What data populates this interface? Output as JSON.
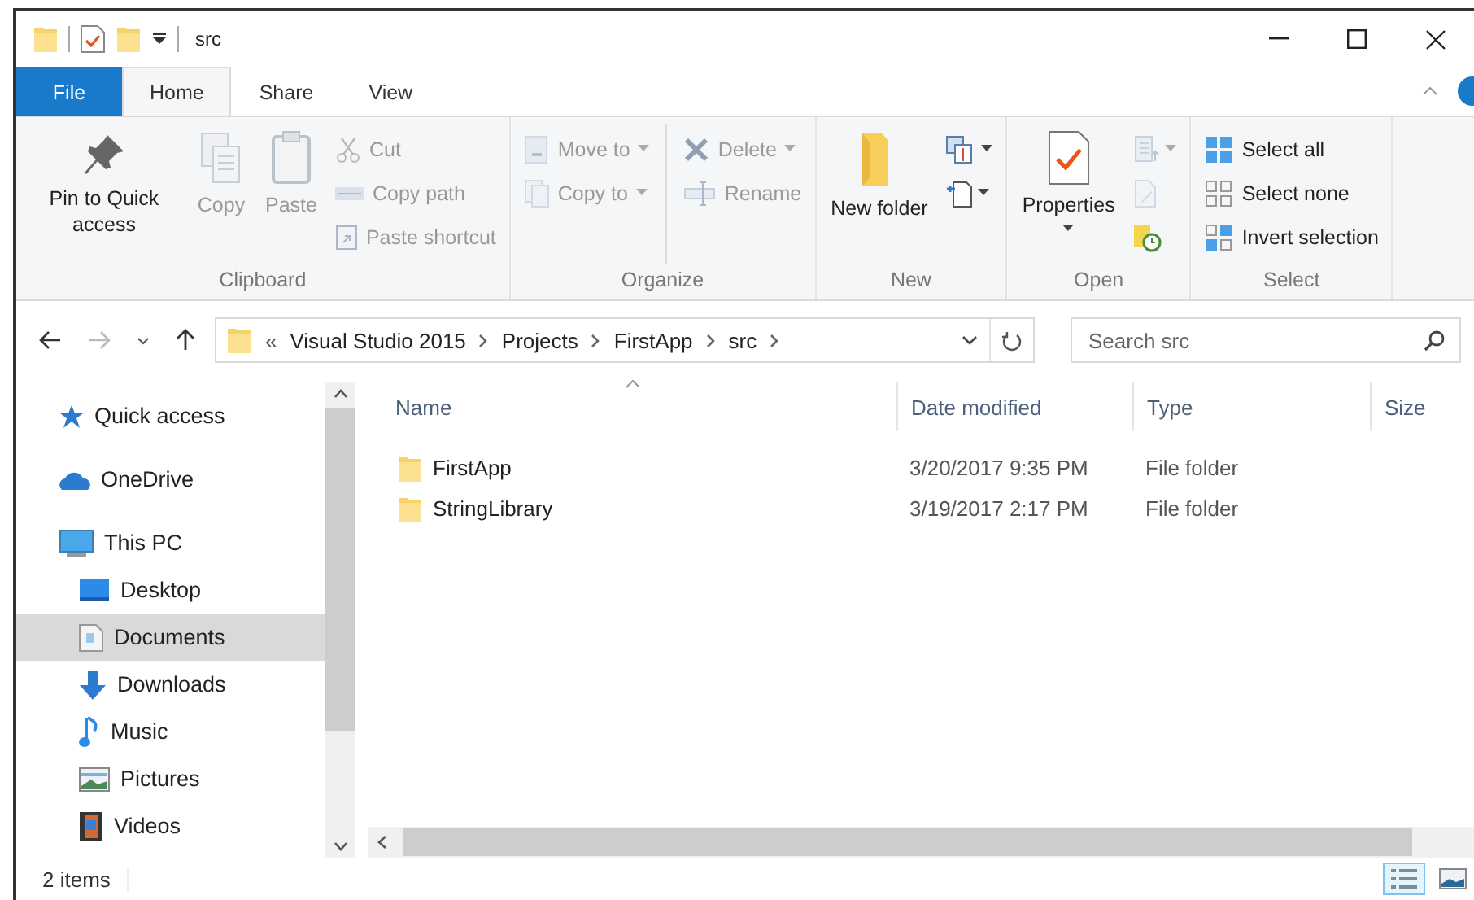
{
  "title_bar": {
    "title": "src"
  },
  "ribbon_tabs": [
    {
      "label": "File",
      "kind": "file",
      "selected": false
    },
    {
      "label": "Home",
      "kind": "tab",
      "selected": true
    },
    {
      "label": "Share",
      "kind": "tab",
      "selected": false
    },
    {
      "label": "View",
      "kind": "tab",
      "selected": false
    }
  ],
  "ribbon_groups": [
    {
      "label": "Clipboard",
      "columns": [
        {
          "items": [
            {
              "kind": "large",
              "label": "Pin to Quick access",
              "disabled": false,
              "dropdown": false
            }
          ]
        },
        {
          "items": [
            {
              "kind": "large",
              "label": "Copy",
              "disabled": true,
              "dropdown": false
            }
          ]
        },
        {
          "items": [
            {
              "kind": "large",
              "label": "Paste",
              "disabled": true,
              "dropdown": false
            }
          ]
        },
        {
          "items": [
            {
              "kind": "small",
              "label": "Cut",
              "disabled": true,
              "dropdown": false
            },
            {
              "kind": "small",
              "label": "Copy path",
              "disabled": true,
              "dropdown": false
            },
            {
              "kind": "small",
              "label": "Paste shortcut",
              "disabled": true,
              "dropdown": false
            }
          ]
        }
      ]
    },
    {
      "label": "Organize",
      "columns": [
        {
          "items": [
            {
              "kind": "small",
              "label": "Move to",
              "disabled": true,
              "dropdown": true
            },
            {
              "kind": "small",
              "label": "Copy to",
              "disabled": true,
              "dropdown": true
            }
          ]
        },
        {
          "items": [
            {
              "kind": "small",
              "label": "Delete",
              "disabled": true,
              "dropdown": true
            },
            {
              "kind": "small",
              "label": "Rename",
              "disabled": true,
              "dropdown": false
            }
          ]
        }
      ]
    },
    {
      "label": "New",
      "columns": [
        {
          "items": [
            {
              "kind": "large",
              "label": "New folder",
              "disabled": false,
              "dropdown": false
            }
          ]
        },
        {
          "items": [
            {
              "kind": "icon",
              "disabled": false,
              "dropdown": true
            },
            {
              "kind": "icon",
              "disabled": false,
              "dropdown": true
            }
          ]
        }
      ]
    },
    {
      "label": "Open",
      "columns": [
        {
          "items": [
            {
              "kind": "large",
              "label": "Properties",
              "disabled": false,
              "dropdown": true
            }
          ]
        },
        {
          "items": [
            {
              "kind": "icon",
              "disabled": true,
              "dropdown": true
            },
            {
              "kind": "icon",
              "disabled": true,
              "dropdown": false
            },
            {
              "kind": "icon",
              "disabled": false,
              "dropdown": false
            }
          ]
        }
      ]
    },
    {
      "label": "Select",
      "columns": [
        {
          "items": [
            {
              "kind": "small",
              "label": "Select all",
              "disabled": false,
              "dropdown": false
            },
            {
              "kind": "small",
              "label": "Select none",
              "disabled": false,
              "dropdown": false
            },
            {
              "kind": "small",
              "label": "Invert selection",
              "disabled": false,
              "dropdown": false
            }
          ]
        }
      ]
    }
  ],
  "navigation": {
    "back_disabled": false,
    "forward_disabled": true
  },
  "address_bar": {
    "overflow": "«",
    "crumbs": [
      "Visual Studio 2015",
      "Projects",
      "FirstApp",
      "src"
    ]
  },
  "search": {
    "placeholder": "Search src"
  },
  "sidebar": {
    "items": [
      {
        "label": "Quick access",
        "selected": false
      },
      {
        "label": "OneDrive",
        "selected": false
      },
      {
        "label": "This PC",
        "selected": false,
        "children": [
          {
            "label": "Desktop",
            "selected": false
          },
          {
            "label": "Documents",
            "selected": true
          },
          {
            "label": "Downloads",
            "selected": false
          },
          {
            "label": "Music",
            "selected": false
          },
          {
            "label": "Pictures",
            "selected": false
          },
          {
            "label": "Videos",
            "selected": false
          }
        ]
      }
    ]
  },
  "file_list": {
    "columns": [
      "Name",
      "Date modified",
      "Type",
      "Size"
    ],
    "rows": [
      {
        "name": "FirstApp",
        "date_modified": "3/20/2017 9:35 PM",
        "type": "File folder",
        "selected": false
      },
      {
        "name": "StringLibrary",
        "date_modified": "3/19/2017 2:17 PM",
        "type": "File folder",
        "selected": false
      }
    ]
  },
  "status_bar": {
    "item_count": "2 items",
    "views": [
      {
        "selected": true
      },
      {
        "selected": false
      }
    ]
  }
}
